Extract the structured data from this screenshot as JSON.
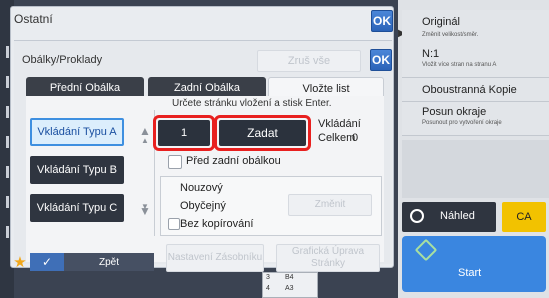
{
  "outer_dialog": {
    "title": "Ostatní",
    "ok_label": "OK"
  },
  "inner_dialog": {
    "title": "Obálky/Proklady",
    "clear_label": "Zruš vše",
    "ok_label": "OK"
  },
  "tabs": [
    {
      "label": "Přední Obálka"
    },
    {
      "label": "Zadní Obálka"
    },
    {
      "label": "Vložte list"
    }
  ],
  "instruction": "Určete stránku vložení a stisk Enter.",
  "insert_types": [
    {
      "label": "Vkládání Typu A"
    },
    {
      "label": "Vkládání Typu B"
    },
    {
      "label": "Vkládání Typu C"
    }
  ],
  "page_input": {
    "value": "1"
  },
  "enter_button": {
    "label": "Zadat"
  },
  "total_label": {
    "line1": "Vkládání",
    "line2": "Celkem",
    "value": "0"
  },
  "before_back_cover": {
    "label": "Před zadní obálkou"
  },
  "paper_options": {
    "line1": "Nouzový",
    "line2": "Obyčejný",
    "change_label": "Změnit"
  },
  "no_copy": {
    "label": "Bez kopírování"
  },
  "bottom_buttons": {
    "tray_setting": "Nastavení Zásobníku",
    "graphic_edit": "Grafická Úprava Stránky"
  },
  "right_panel": {
    "items": [
      {
        "title": "Originál",
        "subtitle": "Změnit velikost/směr."
      },
      {
        "title": "N:1",
        "subtitle": "Vložit více stran na stranu A"
      },
      {
        "title": "Oboustranná Kopie",
        "subtitle": ""
      },
      {
        "title": "Posun okraje",
        "subtitle": "Posunout pro vytvoření okraje"
      }
    ],
    "preview_label": "Náhled",
    "ca_label": "CA",
    "start_label": "Start"
  },
  "bottom_bar": {
    "back_label": "Zpět",
    "paper_sizes": [
      "B4",
      "A3"
    ],
    "tray_numbers": [
      "3",
      "4"
    ]
  },
  "colors": {
    "accent_red": "#e8201f",
    "selected_blue": "#3e8fe0",
    "ca_yellow": "#f2c200",
    "start_blue": "#3a86e0"
  }
}
